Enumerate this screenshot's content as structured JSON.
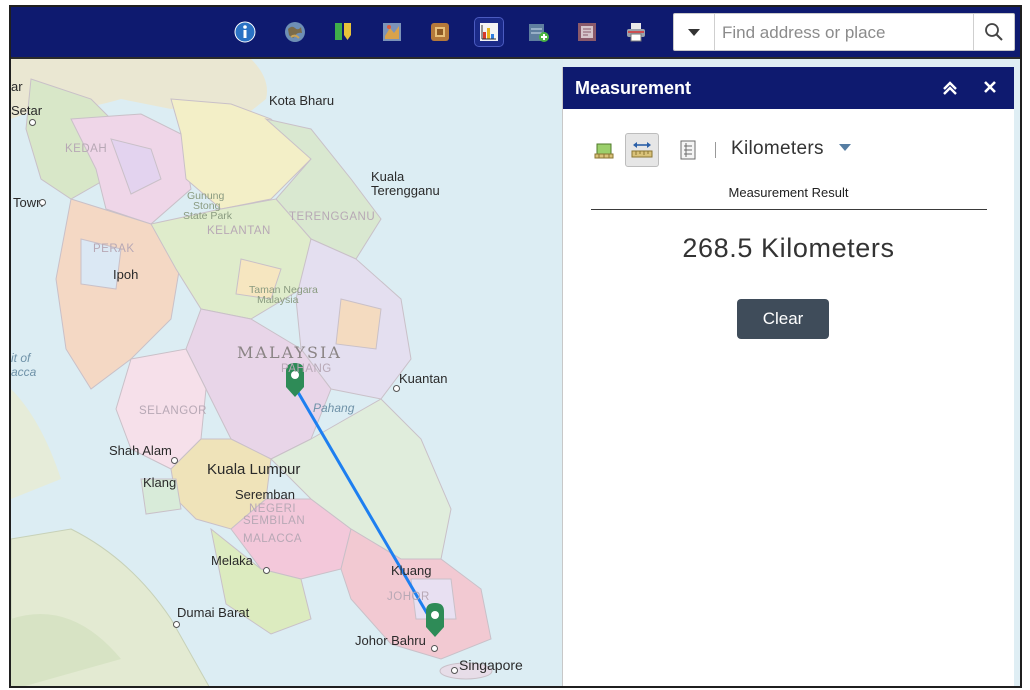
{
  "search": {
    "placeholder": "Find address or place"
  },
  "toolbar": {
    "icons": [
      "about-icon",
      "basemap-gallery-icon",
      "bookmark-icon",
      "layer-list-icon",
      "legend-icon",
      "measurement-icon",
      "add-data-icon",
      "print-preview-icon",
      "print-icon"
    ]
  },
  "map": {
    "labels": {
      "kota_bharu": "Kota Bharu",
      "kuala": "Kuala",
      "terengganu": "Terengganu",
      "terengganu_state": "TERENGGANU",
      "kelantan": "KELANTAN",
      "kedah": "KEDAH",
      "perak": "PERAK",
      "ipoh": "Ipoh",
      "setar": "Setar",
      "town": "Town",
      "gunung": "Gunung",
      "stong": "Stong",
      "state_park": "State Park",
      "taman_negara": "Taman Negara",
      "malaysia_small": "Malaysia",
      "malaysia": "MALAYSIA",
      "pahang_state": "PAHANG",
      "pahang_river": "Pahang",
      "kuantan": "Kuantan",
      "selangor": "SELANGOR",
      "shah_alam": "Shah Alam",
      "kuala_lumpur": "Kuala Lumpur",
      "klang": "Klang",
      "seremban": "Seremban",
      "negeri": "NEGERI",
      "sembilan": "SEMBILAN",
      "malacca_state": "MALACCA",
      "melaka": "Melaka",
      "kluang": "Kluang",
      "johor": "JOHOR",
      "dumai_barat": "Dumai Barat",
      "johor_bahru": "Johor Bahru",
      "singapore": "Singapore",
      "strait_1": "it of",
      "strait_2": "acca",
      "alor": "ar"
    },
    "measure_line_color": "#1e7ff0",
    "marker_color": "#2e8b57"
  },
  "panel": {
    "title": "Measurement",
    "unit": "Kilometers",
    "result_label": "Measurement Result",
    "result_value": "268.5 Kilometers",
    "clear_label": "Clear"
  },
  "colors": {
    "header": "#0e1a6f",
    "button": "#3f4c5a"
  }
}
